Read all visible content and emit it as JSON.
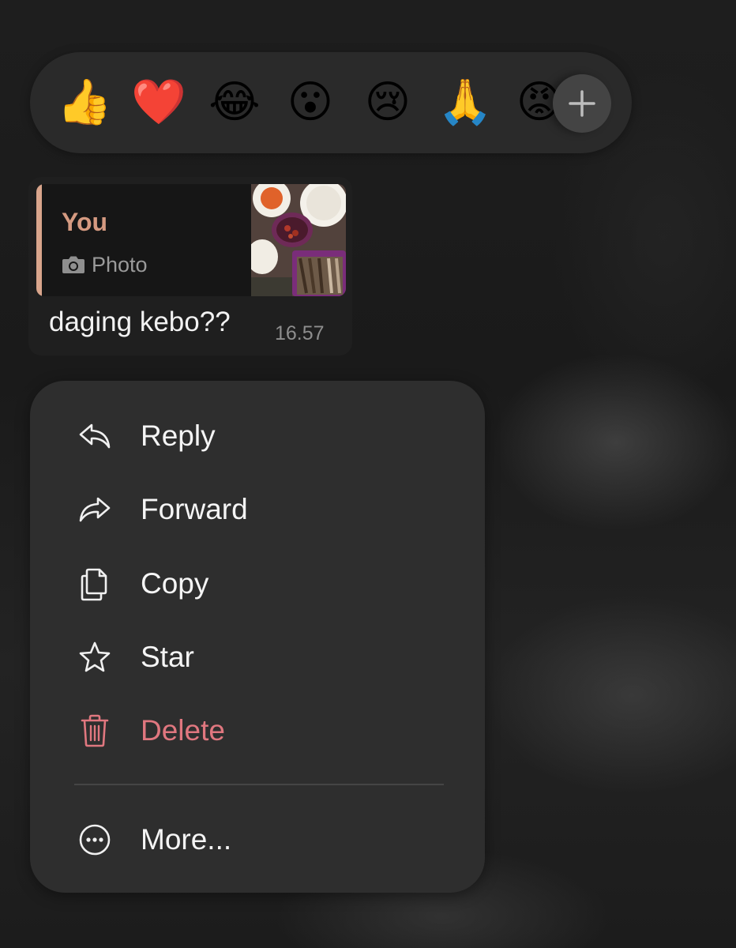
{
  "reactions": {
    "emojis": [
      {
        "glyph": "👍",
        "name": "thumbs-up"
      },
      {
        "glyph": "❤️",
        "name": "red-heart"
      },
      {
        "glyph": "😂",
        "name": "tears-of-joy"
      },
      {
        "glyph": "😮",
        "name": "open-mouth"
      },
      {
        "glyph": "😢",
        "name": "crying-face"
      },
      {
        "glyph": "🙏",
        "name": "folded-hands"
      },
      {
        "glyph": "😡",
        "name": "angry-face"
      }
    ],
    "add_icon": "plus-icon"
  },
  "message": {
    "quote": {
      "author": "You",
      "type_icon": "camera-icon",
      "type_label": "Photo",
      "accent_color": "#d9a58c"
    },
    "text": "daging kebo??",
    "time": "16.57"
  },
  "menu": {
    "items": [
      {
        "label": "Reply",
        "icon": "reply-icon"
      },
      {
        "label": "Forward",
        "icon": "forward-icon"
      },
      {
        "label": "Copy",
        "icon": "copy-icon"
      },
      {
        "label": "Star",
        "icon": "star-icon"
      },
      {
        "label": "Delete",
        "icon": "trash-icon",
        "color": "#e0777f"
      },
      {
        "label": "More...",
        "icon": "more-icon"
      }
    ]
  }
}
